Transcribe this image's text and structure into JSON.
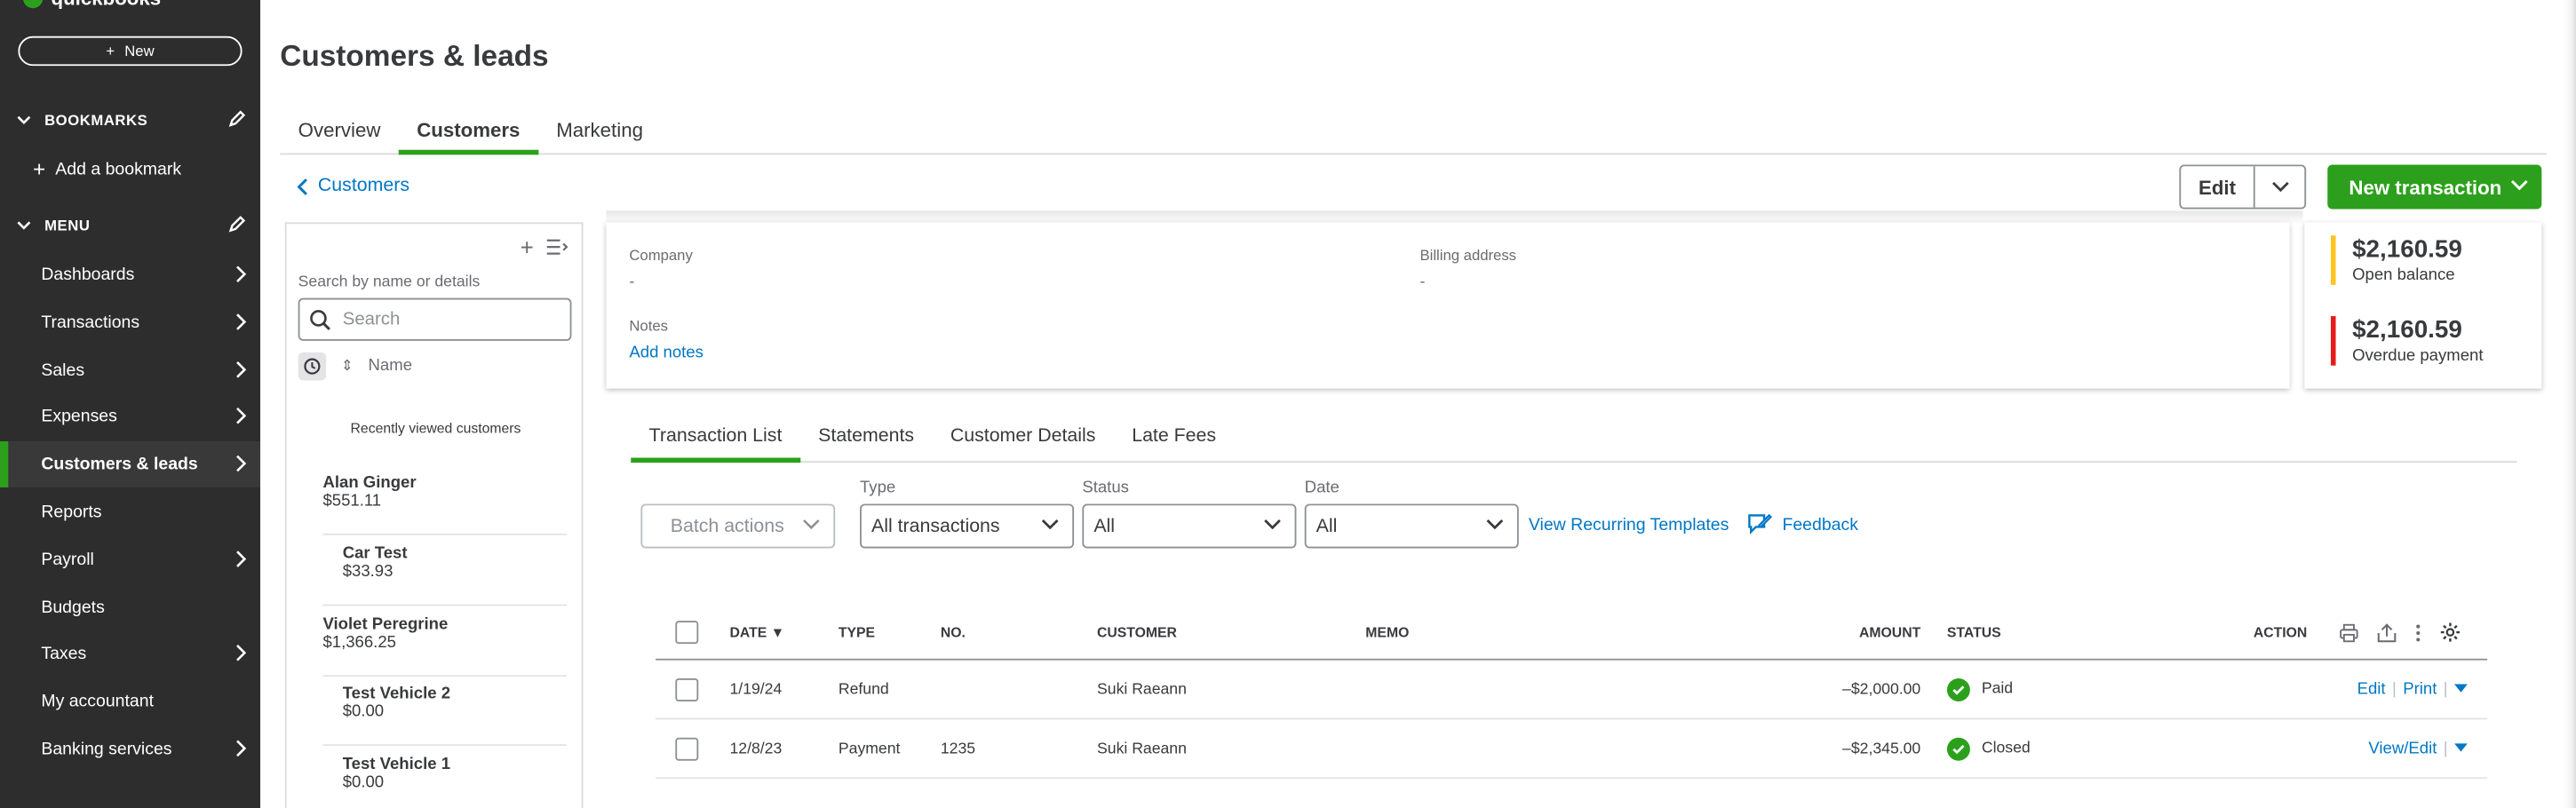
{
  "sidebar": {
    "logo_text": "quickbooks",
    "new_label": "New",
    "bookmarks_title": "BOOKMARKS",
    "add_bookmark": "Add a bookmark",
    "menu_title": "MENU",
    "items": [
      {
        "label": "Dashboards",
        "has_chevron": true
      },
      {
        "label": "Transactions",
        "has_chevron": true
      },
      {
        "label": "Sales",
        "has_chevron": true
      },
      {
        "label": "Expenses",
        "has_chevron": true
      },
      {
        "label": "Customers & leads",
        "has_chevron": true,
        "active": true
      },
      {
        "label": "Reports",
        "has_chevron": false
      },
      {
        "label": "Payroll",
        "has_chevron": true
      },
      {
        "label": "Budgets",
        "has_chevron": false
      },
      {
        "label": "Taxes",
        "has_chevron": true
      },
      {
        "label": "My accountant",
        "has_chevron": false
      },
      {
        "label": "Banking services",
        "has_chevron": true
      }
    ]
  },
  "page": {
    "title": "Customers & leads",
    "tabs": [
      "Overview",
      "Customers",
      "Marketing"
    ],
    "active_tab": "Customers",
    "back_label": "Customers",
    "edit_label": "Edit",
    "new_transaction_label": "New transaction"
  },
  "customer_list": {
    "search_hint": "Search by name or details",
    "search_placeholder": "Search",
    "sort_label": "Name",
    "recent_title": "Recently viewed customers",
    "customers": [
      {
        "name": "Alan Ginger",
        "amount": "$551.11"
      },
      {
        "name": "Car Test",
        "amount": "$33.93"
      },
      {
        "name": "Violet Peregrine",
        "amount": "$1,366.25"
      },
      {
        "name": "Test Vehicle 2",
        "amount": "$0.00"
      },
      {
        "name": "Test Vehicle 1",
        "amount": "$0.00"
      }
    ]
  },
  "details": {
    "company_label": "Company",
    "company_value": "-",
    "billing_label": "Billing address",
    "billing_value": "-",
    "notes_label": "Notes",
    "add_notes": "Add notes"
  },
  "balances": {
    "open_amount": "$2,160.59",
    "open_label": "Open balance",
    "overdue_amount": "$2,160.59",
    "overdue_label": "Overdue payment"
  },
  "sub_tabs": [
    "Transaction List",
    "Statements",
    "Customer Details",
    "Late Fees"
  ],
  "filters": {
    "batch_actions": "Batch actions",
    "type_label": "Type",
    "type_value": "All transactions",
    "status_label": "Status",
    "status_value": "All",
    "date_label": "Date",
    "date_value": "All",
    "recurring_link": "View Recurring Templates",
    "feedback": "Feedback"
  },
  "table": {
    "headers": {
      "date": "DATE ▼",
      "type": "TYPE",
      "no": "NO.",
      "customer": "CUSTOMER",
      "memo": "MEMO",
      "amount": "AMOUNT",
      "status": "STATUS",
      "action": "ACTION"
    },
    "rows": [
      {
        "date": "1/19/24",
        "type": "Refund",
        "no": "",
        "customer": "Suki Raeann",
        "memo": "",
        "amount": "–$2,000.00",
        "status": "Paid",
        "action1": "Edit",
        "action2": "Print"
      },
      {
        "date": "12/8/23",
        "type": "Payment",
        "no": "1235",
        "customer": "Suki Raeann",
        "memo": "",
        "amount": "–$2,345.00",
        "status": "Closed",
        "action1": "View/Edit",
        "action2": ""
      }
    ]
  },
  "colors": {
    "brand_green": "#2ca01c",
    "link_blue": "#0077c5",
    "sidebar_bg": "#2d2d2d",
    "open_balance_bar": "#ffc423",
    "overdue_bar": "#e81b1b"
  }
}
